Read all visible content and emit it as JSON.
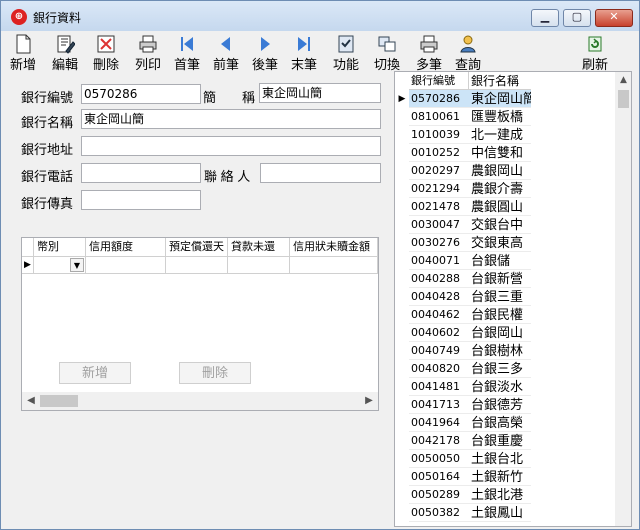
{
  "window": {
    "title": "銀行資料"
  },
  "toolbar": [
    {
      "label": "新增",
      "icon": "new-doc-icon"
    },
    {
      "label": "編輯",
      "icon": "edit-icon"
    },
    {
      "label": "刪除",
      "icon": "delete-icon"
    },
    {
      "label": "列印",
      "icon": "print-icon"
    },
    {
      "label": "首筆",
      "icon": "first-record-icon"
    },
    {
      "label": "前筆",
      "icon": "prev-record-icon"
    },
    {
      "label": "後筆",
      "icon": "next-record-icon"
    },
    {
      "label": "末筆",
      "icon": "last-record-icon"
    },
    {
      "label": "功能",
      "icon": "function-icon"
    },
    {
      "label": "切換",
      "icon": "switch-icon"
    },
    {
      "label": "多筆",
      "icon": "multi-record-icon"
    },
    {
      "label": "查詢",
      "icon": "query-icon"
    },
    {
      "label": "刷新",
      "icon": "refresh-icon"
    }
  ],
  "form": {
    "bank_code_label": "銀行編號",
    "bank_code_value": "0570286",
    "short_label": "簡　　稱",
    "short_value": "東企岡山簡",
    "bank_name_label": "銀行名稱",
    "bank_name_value": "東企岡山簡",
    "address_label": "銀行地址",
    "address_value": "",
    "phone_label": "銀行電話",
    "phone_value": "",
    "contact_label": "聯 絡 人",
    "contact_value": "",
    "fax_label": "銀行傳真",
    "fax_value": ""
  },
  "grid": {
    "columns": [
      "幣別",
      "信用額度",
      "預定償還天",
      "貸款未還",
      "信用狀未贖金額"
    ]
  },
  "buttons": {
    "add": "新增",
    "delete": "刪除"
  },
  "list": {
    "headers": [
      "銀行編號",
      "銀行名稱"
    ],
    "rows": [
      {
        "code": "0570286",
        "name": "東企岡山簡"
      },
      {
        "code": "0810061",
        "name": "匯豐板橋"
      },
      {
        "code": "1010039",
        "name": "北一建成"
      },
      {
        "code": "0010252",
        "name": "中信雙和"
      },
      {
        "code": "0020297",
        "name": "農銀岡山"
      },
      {
        "code": "0021294",
        "name": "農銀介壽"
      },
      {
        "code": "0021478",
        "name": "農銀圓山"
      },
      {
        "code": "0030047",
        "name": "交銀台中"
      },
      {
        "code": "0030276",
        "name": "交銀東高"
      },
      {
        "code": "0040071",
        "name": "台銀儲"
      },
      {
        "code": "0040288",
        "name": "台銀新營"
      },
      {
        "code": "0040428",
        "name": "台銀三重"
      },
      {
        "code": "0040462",
        "name": "台銀民權"
      },
      {
        "code": "0040602",
        "name": "台銀岡山"
      },
      {
        "code": "0040749",
        "name": "台銀樹林"
      },
      {
        "code": "0040820",
        "name": "台銀三多"
      },
      {
        "code": "0041481",
        "name": "台銀淡水"
      },
      {
        "code": "0041713",
        "name": "台銀德芳"
      },
      {
        "code": "0041964",
        "name": "台銀高榮"
      },
      {
        "code": "0042178",
        "name": "台銀重慶"
      },
      {
        "code": "0050050",
        "name": "土銀台北"
      },
      {
        "code": "0050164",
        "name": "土銀新竹"
      },
      {
        "code": "0050289",
        "name": "土銀北港"
      },
      {
        "code": "0050382",
        "name": "土銀鳳山"
      }
    ]
  }
}
